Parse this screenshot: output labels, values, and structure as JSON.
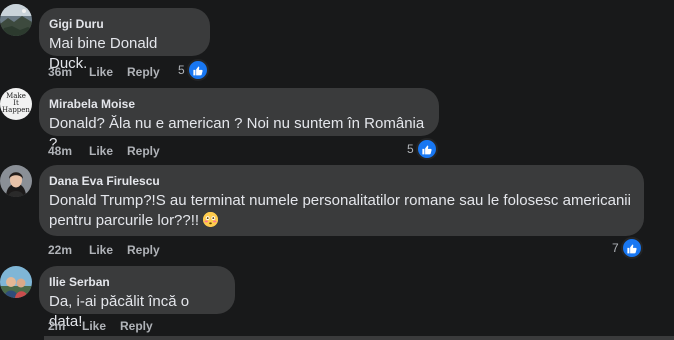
{
  "comments": [
    {
      "author": "Gigi Duru",
      "text": "Mai bine Donald Duck.",
      "time": "36m",
      "like": "Like",
      "reply": "Reply",
      "reactions": "5",
      "avatar_icon": "scenery-avatar-icon"
    },
    {
      "author": "Mirabela Moise",
      "text": "Donald? Ăla nu e american ? Noi nu suntem în România ?",
      "time": "48m",
      "like": "Like",
      "reply": "Reply",
      "reactions": "5",
      "avatar_text": "Make It Happen"
    },
    {
      "author": "Dana Eva Firulescu",
      "text_line1": "Donald Trump?!S au terminat numele personalitatilor romane sau le folosesc americanii",
      "text_line2": "pentru parcurile lor??!!",
      "time": "22m",
      "like": "Like",
      "reply": "Reply",
      "reactions": "7",
      "emoji": "flushed-face-emoji"
    },
    {
      "author": "Ilie Serban",
      "text": "Da, i-ai păcălit încă o data!",
      "time": "2m",
      "like": "Like",
      "reply": "Reply"
    }
  ],
  "colors": {
    "background": "#18191a",
    "bubble": "#3a3b3c",
    "text": "#e4e6eb",
    "secondary": "#b0b3b8",
    "like_blue": "#1877f2"
  }
}
